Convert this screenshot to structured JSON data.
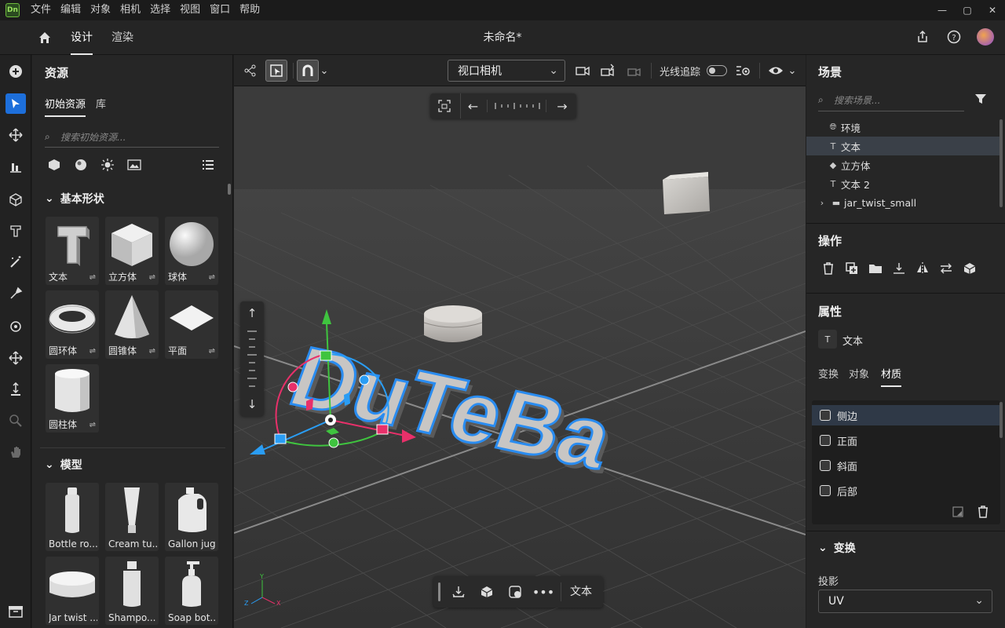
{
  "app": {
    "logo_text": "Dn",
    "doc_title": "未命名*"
  },
  "menu": [
    "文件",
    "编辑",
    "对象",
    "相机",
    "选择",
    "视图",
    "窗口",
    "帮助"
  ],
  "tabs": {
    "design": "设计",
    "render": "渲染"
  },
  "assets": {
    "title": "资源",
    "subtabs": [
      "初始资源",
      "库"
    ],
    "search_placeholder": "搜索初始资源...",
    "group_basic": "基本形状",
    "group_models": "模型",
    "basic_shapes": [
      "文本",
      "立方体",
      "球体",
      "圆环体",
      "圆锥体",
      "平面",
      "圆柱体"
    ],
    "models": [
      "Bottle ro...",
      "Cream tu...",
      "Gallon jug",
      "Jar twist ...",
      "Shampo...",
      "Soap bot..."
    ]
  },
  "viewport": {
    "camera": "视口相机",
    "raytrace_label": "光线追踪",
    "raytrace_on": false,
    "bottom_label": "文本",
    "text_3d": "DuTeBa",
    "axis": {
      "x": "X",
      "y": "Y",
      "z": "Z"
    }
  },
  "scene": {
    "title": "场景",
    "search_placeholder": "搜索场景...",
    "items": [
      {
        "label": "环境",
        "selected": false
      },
      {
        "label": "文本",
        "selected": true
      },
      {
        "label": "立方体",
        "selected": false
      },
      {
        "label": "文本 2",
        "selected": false
      },
      {
        "label": "jar_twist_small",
        "selected": false
      }
    ]
  },
  "operations": {
    "title": "操作"
  },
  "properties": {
    "title": "属性",
    "object_name": "文本",
    "tabs": [
      "变换",
      "对象",
      "材质"
    ],
    "active_tab": "材质",
    "materials": [
      "侧边",
      "正面",
      "斜面",
      "后部"
    ],
    "transform_title": "变换",
    "projection_label": "投影",
    "projection_value": "UV"
  },
  "colors": {
    "accent": "#1d6fdb",
    "selection_outline": "#2a8cf0",
    "gizmo_green": "#3fc43f",
    "gizmo_red": "#e8306a",
    "gizmo_blue": "#2a9df4"
  }
}
